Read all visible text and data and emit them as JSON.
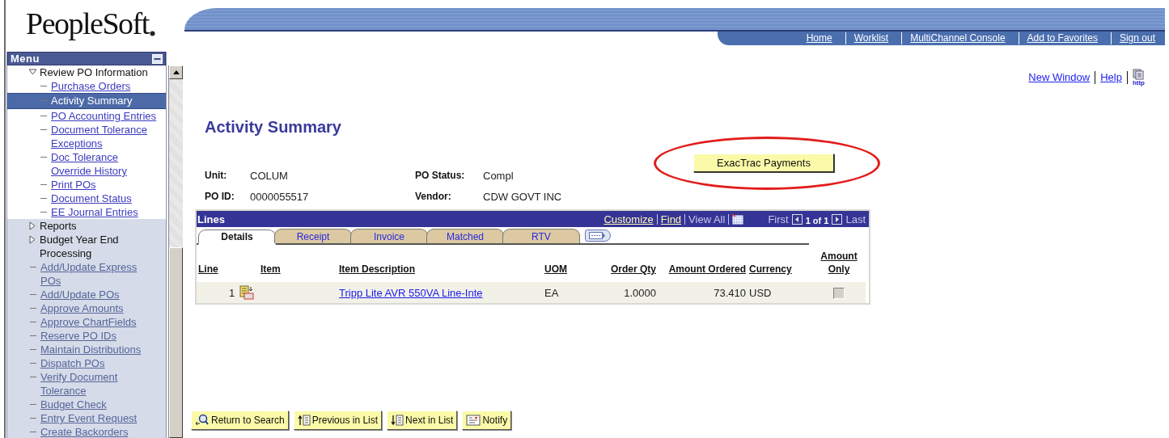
{
  "logo": {
    "text": "PeopleSoft"
  },
  "header_links": [
    "Home",
    "Worklist",
    "MultiChannel Console",
    "Add to Favorites",
    "Sign out"
  ],
  "menu": {
    "title": "Menu",
    "items": [
      {
        "label": "Review PO Information",
        "kind": "folder",
        "expanded": true,
        "children": [
          {
            "label": "Purchase Orders",
            "kind": "link",
            "selected": false
          },
          {
            "label": "Activity Summary",
            "kind": "link",
            "selected": true
          },
          {
            "label": "PO Accounting Entries",
            "kind": "link",
            "selected": false
          },
          {
            "label": "Document Tolerance Exceptions",
            "kind": "link",
            "selected": false
          },
          {
            "label": "Doc Tolerance Override History",
            "kind": "link",
            "selected": false
          },
          {
            "label": "Print POs",
            "kind": "link",
            "selected": false
          },
          {
            "label": "Document Status",
            "kind": "link",
            "selected": false
          },
          {
            "label": "EE Journal Entries",
            "kind": "link",
            "selected": false
          }
        ]
      },
      {
        "label": "Reports",
        "kind": "folder",
        "expanded": false
      },
      {
        "label": "Budget Year End Processing",
        "kind": "folder",
        "expanded": false
      },
      {
        "label": "Add/Update Express POs",
        "kind": "link",
        "selected": false
      },
      {
        "label": "Add/Update POs",
        "kind": "link",
        "selected": false
      },
      {
        "label": "Approve Amounts",
        "kind": "link",
        "selected": false
      },
      {
        "label": "Approve ChartFields",
        "kind": "link",
        "selected": false
      },
      {
        "label": "Reserve PO IDs",
        "kind": "link",
        "selected": false
      },
      {
        "label": "Maintain Distributions",
        "kind": "link",
        "selected": false
      },
      {
        "label": "Dispatch POs",
        "kind": "link",
        "selected": false
      },
      {
        "label": "Verify Document Tolerance",
        "kind": "link",
        "selected": false
      },
      {
        "label": "Budget Check",
        "kind": "link",
        "selected": false
      },
      {
        "label": "Entry Event Request",
        "kind": "link",
        "selected": false
      },
      {
        "label": "Create Backorders",
        "kind": "link",
        "selected": false
      }
    ]
  },
  "page_links": [
    {
      "label": "New Window",
      "kind": "text"
    },
    {
      "label": "Help",
      "kind": "text"
    },
    {
      "label": "http",
      "kind": "icon"
    }
  ],
  "title": "Activity Summary",
  "fields": [
    {
      "label": "Unit:",
      "value": "COLUM"
    },
    {
      "label": "PO Status:",
      "value": "Compl"
    },
    {
      "label": "PO ID:",
      "value": "0000055517"
    },
    {
      "label": "Vendor:",
      "value": "CDW GOVT INC"
    }
  ],
  "action_button": {
    "label": "ExacTrac Payments",
    "highlighted": true
  },
  "grid": {
    "title": "Lines",
    "nav_links": [
      {
        "label": "Customize",
        "disabled": false
      },
      {
        "label": "Find",
        "disabled": false
      },
      {
        "label": "View All",
        "disabled": true
      }
    ],
    "first": {
      "label": "First",
      "disabled": true
    },
    "counter": "1 of 1",
    "last": {
      "label": "Last",
      "disabled": true
    },
    "tabs": [
      {
        "label": "Details",
        "selected": true
      },
      {
        "label": "Receipt",
        "selected": false
      },
      {
        "label": "Invoice",
        "selected": false
      },
      {
        "label": "Matched",
        "selected": false
      },
      {
        "label": "RTV",
        "selected": false
      }
    ],
    "columns": [
      "Line",
      "Item",
      "Item Description",
      "UOM",
      "Order Qty",
      "Amount Ordered",
      "Currency",
      "Amount Only"
    ],
    "rows": [
      {
        "line": "1",
        "description": "Tripp Lite AVR 550VA Line-Inte",
        "uom": "EA",
        "order_qty": "1.0000",
        "amount_ordered": "73.410",
        "currency": "USD",
        "amount_only": {
          "checked": false,
          "disabled": true
        }
      }
    ]
  },
  "buttons": [
    {
      "label": "Return to Search",
      "kind": "search"
    },
    {
      "label": "Previous in List",
      "kind": "previous"
    },
    {
      "label": "Next in List",
      "kind": "next"
    },
    {
      "label": "Notify",
      "kind": "notify"
    }
  ]
}
